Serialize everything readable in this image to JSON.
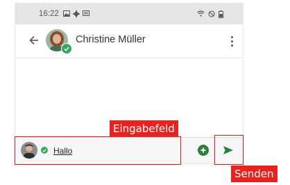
{
  "statusbar": {
    "time": "16:22",
    "left_icons": [
      "image-icon",
      "gear-icon",
      "message-icon"
    ],
    "right_icons": [
      "wifi-icon",
      "do-not-disturb-icon",
      "battery-icon"
    ]
  },
  "appbar": {
    "back_icon": "arrow-left-icon",
    "contact_name": "Christine Müller",
    "contact_verified": true,
    "menu_icon": "more-vertical-icon"
  },
  "composer": {
    "user_verified": true,
    "input_value": "Hallo",
    "add_icon": "plus-circle-icon",
    "send_icon": "send-icon"
  },
  "annotations": {
    "input_label": "Eingabefeld",
    "send_label": "Senden"
  },
  "colors": {
    "accent_green": "#3aa760",
    "dark_green": "#2f7d3f",
    "annotation_red": "#e8221e"
  }
}
